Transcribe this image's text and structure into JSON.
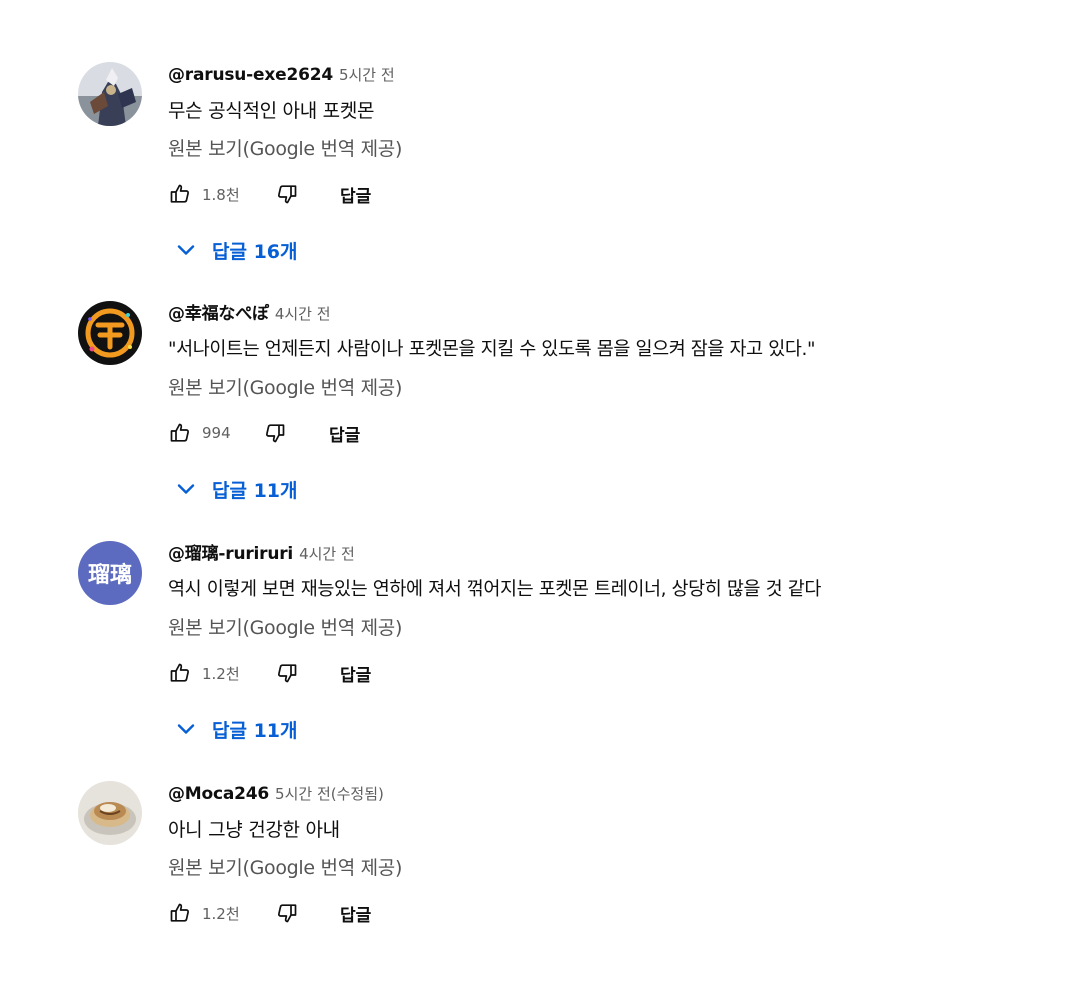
{
  "comments": [
    {
      "author": "@rarusu-exe2624",
      "time": "5시간 전",
      "text": "무슨 공식적인 아내 포켓몬",
      "translate_label": "원본 보기(Google 번역 제공)",
      "likes": "1.8천",
      "reply_label": "답글",
      "replies_label": "답글 16개",
      "avatar_icon": "photo-avatar-figure-icon"
    },
    {
      "author": "@幸福なぺぽ",
      "time": "4시간 전",
      "text": "\"서나이트는 언제든지 사람이나 포켓몬을 지킬 수 있도록 몸을 일으켜 잠을 자고 있다.\"",
      "translate_label": "원본 보기(Google 번역 제공)",
      "likes": "994",
      "reply_label": "답글",
      "replies_label": "답글 11개",
      "avatar_icon": "logo-avatar-icon"
    },
    {
      "author": "@瑠璃-ruriruri",
      "time": "4시간 전",
      "text": "역시 이렇게 보면 재능있는 연하에 져서 꺾어지는 포켓몬 트레이너, 상당히 많을 것 같다",
      "translate_label": "원본 보기(Google 번역 제공)",
      "likes": "1.2천",
      "reply_label": "답글",
      "replies_label": "답글 11개",
      "avatar_initials": "瑠璃",
      "avatar_color": "#5c6bc0"
    },
    {
      "author": "@Moca246",
      "time": "5시간 전(수정됨)",
      "text": "아니 그냥 건강한 아내",
      "translate_label": "원본 보기(Google 번역 제공)",
      "likes": "1.2천",
      "reply_label": "답글",
      "avatar_icon": "photo-avatar-food-icon"
    }
  ],
  "colors": {
    "link_blue": "#065fd4",
    "meta_gray": "#606060",
    "text": "#0f0f0f"
  }
}
